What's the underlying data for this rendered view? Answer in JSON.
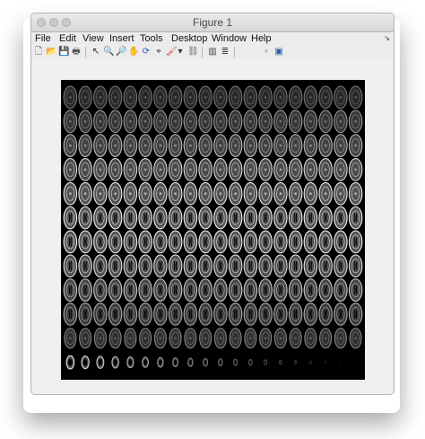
{
  "window": {
    "title": "Figure 1"
  },
  "menu": [
    "File",
    "Edit",
    "View",
    "Insert",
    "Tools",
    "Desktop",
    "Window",
    "Help"
  ],
  "toolbar": [
    {
      "name": "new-figure-icon",
      "glyph": "🗋"
    },
    {
      "name": "open-file-icon",
      "glyph": "📂"
    },
    {
      "name": "save-icon",
      "glyph": "💾"
    },
    {
      "name": "print-icon",
      "glyph": "🖶"
    },
    {
      "name": "pointer-icon",
      "glyph": "↖"
    },
    {
      "name": "zoom-in-icon",
      "glyph": "🔍"
    },
    {
      "name": "zoom-out-icon",
      "glyph": "🔎"
    },
    {
      "name": "pan-icon",
      "glyph": "✋"
    },
    {
      "name": "rotate-3d-icon",
      "glyph": "⟳"
    },
    {
      "name": "data-cursor-icon",
      "glyph": "⌖"
    },
    {
      "name": "brush-icon",
      "glyph": "🖌"
    },
    {
      "name": "brush-dropdown-icon",
      "glyph": "▾"
    },
    {
      "name": "link-plot-icon",
      "glyph": "⛓"
    },
    {
      "name": "colorbar-icon",
      "glyph": "▥"
    },
    {
      "name": "legend-icon",
      "glyph": "≣"
    },
    {
      "name": "hide-plot-tools-icon",
      "glyph": "▫"
    },
    {
      "name": "show-plot-tools-icon",
      "glyph": "▣"
    }
  ],
  "montage": {
    "rows": 12,
    "cols": 20,
    "colormap": "gray"
  }
}
